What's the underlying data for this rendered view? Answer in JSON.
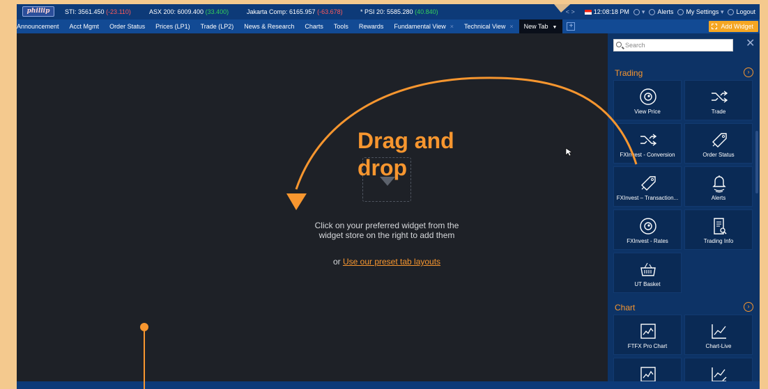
{
  "ticker": {
    "logo": "phillip",
    "items": [
      {
        "label": "STI: 3561.450",
        "change": "(-23.110)",
        "dir": "neg"
      },
      {
        "label": "ASX 200: 6009.400",
        "change": "(33.400)",
        "dir": "pos"
      },
      {
        "label": "Jakarta Comp: 6165.957",
        "change": "(-63.678)",
        "dir": "neg"
      },
      {
        "label": "* PSI 20: 5585.280",
        "change": "(40.840)",
        "dir": "pos"
      }
    ],
    "nav": "<   >",
    "time": "12:08:18 PM",
    "alerts": "Alerts",
    "settings": "My Settings",
    "logout": "Logout"
  },
  "tabs": [
    {
      "label": "Announcement"
    },
    {
      "label": "Acct Mgmt"
    },
    {
      "label": "Order Status"
    },
    {
      "label": "Prices (LP1)"
    },
    {
      "label": "Trade (LP2)"
    },
    {
      "label": "News & Research"
    },
    {
      "label": "Charts"
    },
    {
      "label": "Tools"
    },
    {
      "label": "Rewards"
    },
    {
      "label": "Fundamental View"
    },
    {
      "label": "Technical View"
    },
    {
      "label": "New Tab"
    }
  ],
  "add_widget": "Add Widget",
  "main": {
    "annotation": "Drag and\ndrop",
    "hint_line1": "Click on your preferred widget from the",
    "hint_line2": "widget store on the right to add them",
    "preset_prefix": "or",
    "preset_link": "Use our preset tab layouts"
  },
  "sidebar": {
    "search_placeholder": "Search",
    "sections": [
      {
        "title": "Trading",
        "tiles": [
          {
            "label": "View Price",
            "icon": "eye-icon"
          },
          {
            "label": "Trade",
            "icon": "shuffle-icon"
          },
          {
            "label": "FXInvest - Conversion",
            "icon": "shuffle-icon"
          },
          {
            "label": "Order Status",
            "icon": "tag-icon"
          },
          {
            "label": "FXInvest – Transaction...",
            "icon": "tag-icon"
          },
          {
            "label": "Alerts",
            "icon": "bell-icon"
          },
          {
            "label": "FXInvest - Rates",
            "icon": "eye-icon"
          },
          {
            "label": "Trading Info",
            "icon": "document-search-icon"
          },
          {
            "label": "UT Basket",
            "icon": "basket-icon"
          }
        ]
      },
      {
        "title": "Chart",
        "tiles": [
          {
            "label": "FTFX Pro Chart",
            "icon": "chart-icon"
          },
          {
            "label": "Chart-Live",
            "icon": "line-chart-icon"
          },
          {
            "label": "",
            "icon": "chart-icon"
          },
          {
            "label": "",
            "icon": "chart-edit-icon"
          }
        ]
      }
    ]
  },
  "colors": {
    "accent": "#f7962f",
    "ticker_bg": "#0d3a78",
    "tab_bg": "#124a94",
    "sidebar_bg": "#0d3366",
    "main_bg": "#1e2127"
  }
}
